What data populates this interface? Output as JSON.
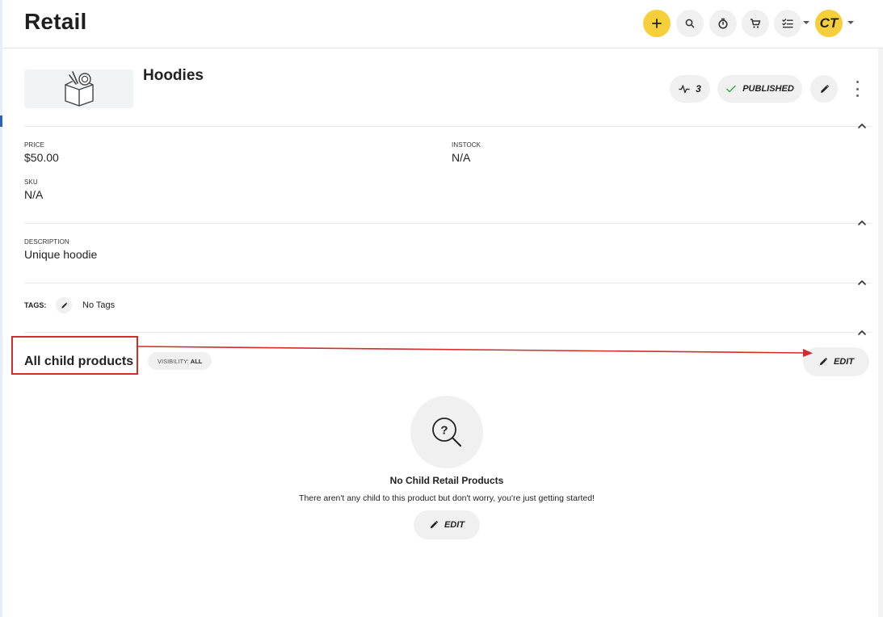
{
  "header": {
    "title": "Retail",
    "avatar_initials": "CT"
  },
  "product": {
    "name": "Hoodies",
    "activity_count": "3",
    "status": "PUBLISHED"
  },
  "fields": {
    "price_label": "PRICE",
    "price_value": "$50.00",
    "instock_label": "INSTOCK",
    "instock_value": "N/A",
    "sku_label": "SKU",
    "sku_value": "N/A",
    "description_label": "DESCRIPTION",
    "description_value": "Unique hoodie"
  },
  "tags": {
    "label": "TAGS:",
    "value": "No Tags"
  },
  "child_products": {
    "title": "All child products",
    "visibility_label": "VISIBILITY:",
    "visibility_value": "ALL",
    "edit_label": "EDIT",
    "empty_title": "No Child Retail Products",
    "empty_description": "There aren't any child to this product but don't worry, you're just getting started!",
    "empty_edit_label": "EDIT"
  },
  "colors": {
    "accent": "#f7cf3b",
    "annotation": "#d42b2b",
    "status_ok": "#2db34a"
  }
}
